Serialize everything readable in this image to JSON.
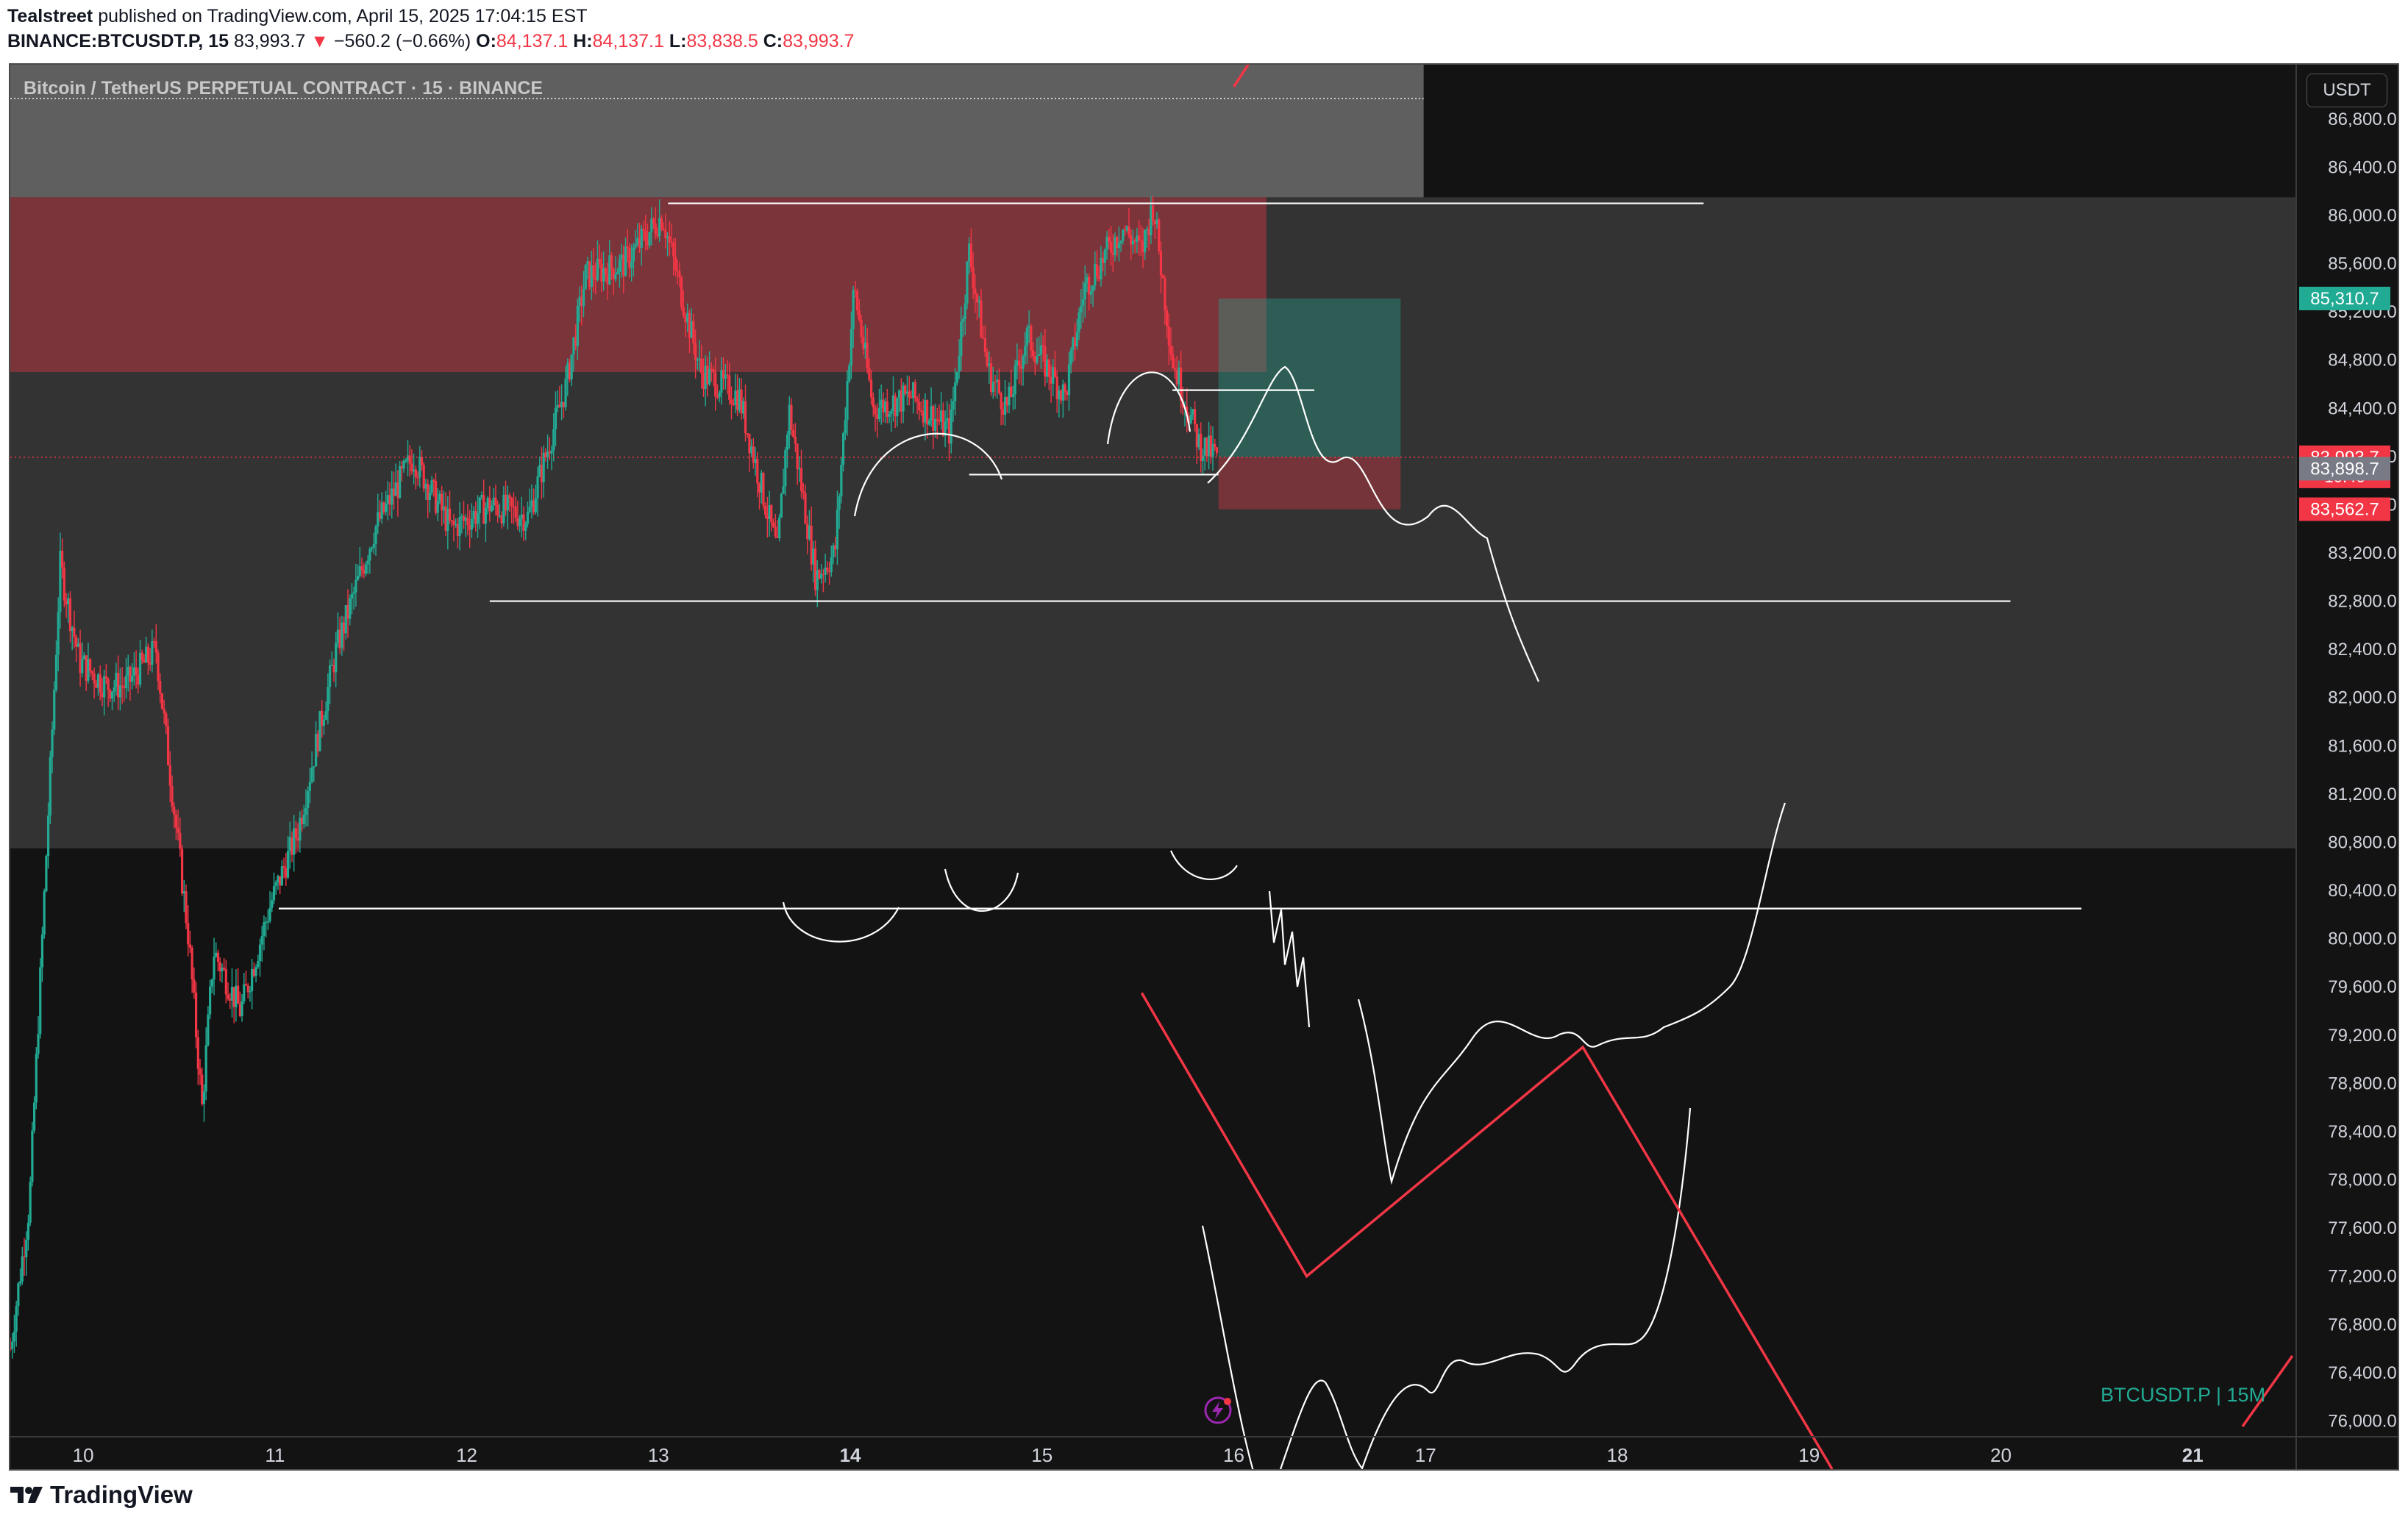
{
  "header": {
    "publisher": "Tealstreet",
    "published_text": "published on TradingView.com, April 15, 2025 17:04:15 EST",
    "symbol": "BINANCE:BTCUSDT.P, 15",
    "last": "83,993.7",
    "change": "−560.2 (−0.66%)",
    "change_arrow": "▼",
    "o_label": "O:",
    "o_value": "84,137.1",
    "h_label": "H:",
    "h_value": "84,137.1",
    "l_label": "L:",
    "l_value": "83,838.5",
    "c_label": "C:",
    "c_value": "83,993.7"
  },
  "chart_title": "Bitcoin / TetherUS PERPETUAL CONTRACT · 15 · BINANCE",
  "currency": "USDT",
  "watermark": "BTCUSDT.P | 15M",
  "footer": {
    "logo_text": "TradingView"
  },
  "colors": {
    "background": "#131313",
    "up": "#22ab94",
    "down": "#f23645",
    "drawing_white": "#ffffff",
    "drawing_red": "#f23645"
  },
  "chart_data": {
    "type": "candlestick",
    "title": "Bitcoin / TetherUS PERPETUAL CONTRACT · 15 · BINANCE",
    "interval": "15",
    "x_ticks": [
      "10",
      "11",
      "12",
      "13",
      "14",
      "15",
      "16",
      "17",
      "18",
      "19",
      "20",
      "21"
    ],
    "x_tick_positions_days": [
      10,
      11,
      12,
      13,
      14,
      15,
      16,
      17,
      18,
      19,
      20,
      21
    ],
    "bold_ticks": [
      "14",
      "21"
    ],
    "x_range_days": [
      9.62,
      21.54
    ],
    "y_ticks": [
      86800,
      86400,
      86000,
      85600,
      85200,
      84800,
      84400,
      84000,
      83600,
      83200,
      82800,
      82400,
      82000,
      81600,
      81200,
      80800,
      80400,
      80000,
      79600,
      79200,
      78800,
      78400,
      78000,
      77600,
      77200,
      76800,
      76400,
      76000
    ],
    "y_range": [
      75600,
      87250
    ],
    "grid": false,
    "price_path_days": [
      9.62,
      9.72,
      9.88,
      9.98,
      10.12,
      10.22,
      10.38,
      10.55,
      10.62,
      10.68,
      10.82,
      10.98,
      11.12,
      11.32,
      11.52,
      11.72,
      11.92,
      12.12,
      12.32,
      12.52,
      12.62,
      12.82,
      13.02,
      13.22,
      13.42,
      13.62,
      13.68,
      13.82,
      13.92,
      14.02,
      14.12,
      14.32,
      14.52,
      14.62,
      14.72,
      14.82,
      14.92,
      15.12,
      15.22,
      15.42,
      15.52,
      15.58,
      15.68,
      15.82,
      15.92
    ],
    "price_path_values": [
      76600,
      77800,
      83100,
      82300,
      82100,
      82100,
      82400,
      80000,
      78600,
      79900,
      79400,
      80300,
      80900,
      82400,
      83400,
      84000,
      83400,
      83600,
      83500,
      84600,
      85500,
      85600,
      86000,
      84700,
      84500,
      83200,
      84400,
      83000,
      83200,
      85400,
      84400,
      84500,
      84200,
      85700,
      84700,
      84400,
      85000,
      84500,
      85400,
      85900,
      85700,
      86100,
      84800,
      84100,
      83994
    ],
    "last_price": 83993.7,
    "countdown": "10:46",
    "price_tags": [
      {
        "value": 85310.7,
        "label": "85,310.7",
        "color": "#22ab94"
      },
      {
        "value": 83993.7,
        "label": "83,993.7",
        "color": "#f23645",
        "sub": "10:46"
      },
      {
        "value": 83898.7,
        "label": "83,898.7",
        "color": "#787b86"
      },
      {
        "value": 83562.7,
        "label": "83,562.7",
        "color": "#f23645"
      }
    ],
    "zones": [
      {
        "name": "supply-zone",
        "x": [
          9.62,
          16.17
        ],
        "y": [
          84700,
          86150
        ],
        "color": "#f23645"
      },
      {
        "name": "top-box",
        "x": [
          9.62,
          16.99
        ],
        "y": [
          86150,
          87250
        ],
        "color": "#ffffff"
      },
      {
        "name": "range-box",
        "x": [
          9.62,
          21.54
        ],
        "y": [
          80750,
          86150
        ],
        "color": "#ffffff"
      },
      {
        "name": "position-target",
        "x": [
          15.92,
          16.87
        ],
        "y": [
          83994,
          85310.7
        ],
        "color": "#22ab94"
      },
      {
        "name": "position-stop",
        "x": [
          15.92,
          16.87
        ],
        "y": [
          83562.7,
          83994
        ],
        "color": "#f23645"
      }
    ],
    "levels": [
      {
        "value": 86100,
        "x": [
          13.05,
          18.45
        ]
      },
      {
        "value": 82800,
        "x": [
          12.12,
          20.05
        ]
      },
      {
        "value": 80250,
        "x": [
          11.02,
          20.42
        ]
      },
      {
        "value": 84550,
        "x": [
          15.68,
          16.42
        ]
      },
      {
        "value": 83850,
        "x": [
          14.62,
          15.92
        ]
      }
    ],
    "red_path_days": [
      15.52,
      16.38,
      17.82,
      19.12
    ],
    "red_path_values": [
      79550,
      77200,
      79100,
      75600
    ]
  }
}
